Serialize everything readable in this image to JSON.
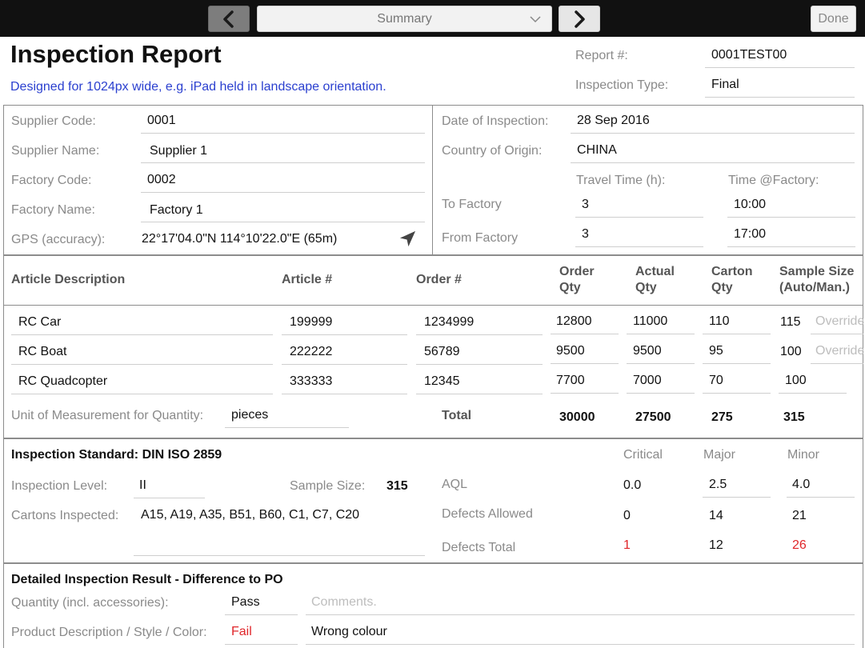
{
  "topbar": {
    "back_icon": "chevron-left-icon",
    "forward_icon": "chevron-right-icon",
    "section_select": "Summary",
    "done_label": "Done"
  },
  "header": {
    "title": "Inspection Report",
    "subtitle": "Designed for 1024px wide, e.g. iPad held in landscape orientation.",
    "report_no_label": "Report #:",
    "report_no": "0001TEST00",
    "inspection_type_label": "Inspection Type:",
    "inspection_type": "Final"
  },
  "supplier": {
    "supplier_code_label": "Supplier Code:",
    "supplier_code": "0001",
    "supplier_name_label": "Supplier Name:",
    "supplier_name": "Supplier 1",
    "factory_code_label": "Factory Code:",
    "factory_code": "0002",
    "factory_name_label": "Factory Name:",
    "factory_name": "Factory 1",
    "gps_label": "GPS (accuracy):",
    "gps": "22°17'04.0\"N 114°10'22.0\"E (65m)",
    "gps_icon": "location-arrow-icon"
  },
  "inspection": {
    "date_label": "Date of Inspection:",
    "date": "28 Sep 2016",
    "country_label": "Country of Origin:",
    "country": "CHINA",
    "travel_time_label": "Travel Time (h):",
    "time_factory_label": "Time @Factory:",
    "to_factory_label": "To Factory",
    "to_factory_travel": "3",
    "to_factory_time": "10:00",
    "from_factory_label": "From Factory",
    "from_factory_travel": "3",
    "from_factory_time": "17:00"
  },
  "articles": {
    "headers": {
      "description": "Article Description",
      "article_no": "Article #",
      "order_no": "Order #",
      "order_qty_1": "Order",
      "order_qty_2": "Qty",
      "actual_qty_1": "Actual",
      "actual_qty_2": "Qty",
      "carton_qty_1": "Carton",
      "carton_qty_2": "Qty",
      "sample_size_1": "Sample Size",
      "sample_size_2": "(Auto/Man.)"
    },
    "rows": [
      {
        "description": "RC Car",
        "article_no": "199999",
        "order_no": "1234999",
        "order_qty": "12800",
        "actual_qty": "11000",
        "carton_qty": "110",
        "sample_size": "115",
        "override": "Override"
      },
      {
        "description": "RC Boat",
        "article_no": "222222",
        "order_no": "56789",
        "order_qty": "9500",
        "actual_qty": "9500",
        "carton_qty": "95",
        "sample_size": "100",
        "override": "Override"
      },
      {
        "description": "RC Quadcopter",
        "article_no": "333333",
        "order_no": "12345",
        "order_qty": "7700",
        "actual_qty": "7000",
        "carton_qty": "70",
        "sample_size": "100",
        "override": ""
      }
    ],
    "uom_label": "Unit of Measurement for Quantity:",
    "uom": "pieces",
    "total_label": "Total",
    "total_order_qty": "30000",
    "total_actual_qty": "27500",
    "total_carton_qty": "275",
    "total_sample_size": "315"
  },
  "standard": {
    "title": "Inspection Standard: DIN ISO 2859",
    "level_label": "Inspection Level:",
    "level": "II",
    "sample_size_label": "Sample Size:",
    "sample_size": "315",
    "cartons_label": "Cartons Inspected:",
    "cartons": "A15, A19, A35, B51, B60, C1, C7, C20",
    "critical_label": "Critical",
    "major_label": "Major",
    "minor_label": "Minor",
    "aql_label": "AQL",
    "aql_critical": "0.0",
    "aql_major": "2.5",
    "aql_minor": "4.0",
    "allowed_label": "Defects Allowed",
    "allowed_critical": "0",
    "allowed_major": "14",
    "allowed_minor": "21",
    "total_label": "Defects Total",
    "total_critical": "1",
    "total_major": "12",
    "total_minor": "26",
    "accent_red": "#e0262a"
  },
  "result": {
    "title": "Detailed Inspection Result - Difference to PO",
    "quantity_label": "Quantity (incl. accessories):",
    "quantity_result": "Pass",
    "quantity_comment_placeholder": "Comments.",
    "product_label": "Product Description / Style / Color:",
    "product_result": "Fail",
    "product_comment": "Wrong colour"
  }
}
